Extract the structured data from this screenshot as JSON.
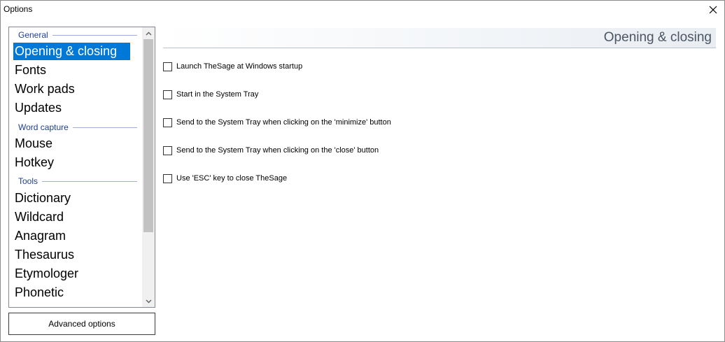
{
  "window": {
    "title": "Options"
  },
  "nav": {
    "groups": [
      {
        "label": "General"
      },
      {
        "label": "Word capture"
      },
      {
        "label": "Tools"
      }
    ],
    "items": [
      {
        "label": "Opening & closing",
        "selected": true
      },
      {
        "label": "Fonts"
      },
      {
        "label": "Work pads"
      },
      {
        "label": "Updates"
      },
      {
        "label": "Mouse"
      },
      {
        "label": "Hotkey"
      },
      {
        "label": "Dictionary"
      },
      {
        "label": "Wildcard"
      },
      {
        "label": "Anagram"
      },
      {
        "label": "Thesaurus"
      },
      {
        "label": "Etymologer"
      },
      {
        "label": "Phonetic"
      }
    ]
  },
  "advanced_button": {
    "label": "Advanced options"
  },
  "section": {
    "title": "Opening & closing"
  },
  "options": [
    {
      "label": "Launch TheSage at Windows startup",
      "checked": false
    },
    {
      "label": "Start in the System Tray",
      "checked": false
    },
    {
      "label": "Send to the System Tray when clicking on the 'minimize' button",
      "checked": false
    },
    {
      "label": "Send to the System Tray when clicking on the 'close' button",
      "checked": false
    },
    {
      "label": "Use 'ESC' key to close TheSage",
      "checked": false
    }
  ],
  "colors": {
    "selection": "#0078d7",
    "group_header": "#1f3f8f"
  }
}
